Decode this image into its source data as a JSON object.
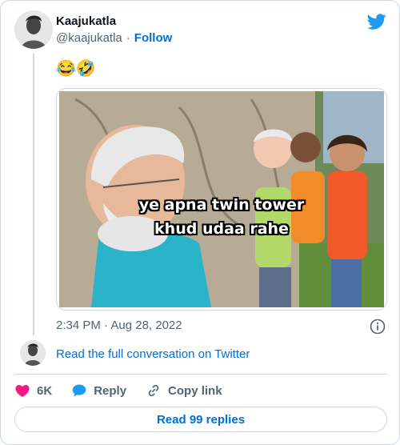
{
  "author": {
    "name": "Kaajukatla",
    "handle": "@kaajukatla",
    "separator": "·",
    "follow_label": "Follow"
  },
  "tweet": {
    "text": "😂🤣",
    "timestamp": "2:34 PM · Aug 28, 2022"
  },
  "media": {
    "caption_line1": "ye apna twin tower",
    "caption_line2": "khud udaa rahe"
  },
  "conversation_link": "Read the full conversation on Twitter",
  "actions": {
    "like_count": "6K",
    "reply_label": "Reply",
    "copy_link_label": "Copy link"
  },
  "replies_button": "Read 99 replies",
  "colors": {
    "link": "#006fd6",
    "like": "#f91880",
    "reply": "#1d9bf0",
    "twitter": "#1d9bf0",
    "border": "#cfd9de"
  }
}
